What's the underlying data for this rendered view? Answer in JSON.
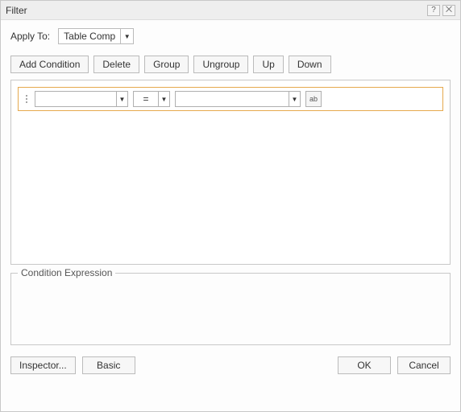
{
  "title": "Filter",
  "applyTo": {
    "label": "Apply To:",
    "value": "Table Comp"
  },
  "toolbar": {
    "addCondition": "Add Condition",
    "delete": "Delete",
    "group": "Group",
    "ungroup": "Ungroup",
    "up": "Up",
    "down": "Down"
  },
  "condition": {
    "field": "",
    "operator": "=",
    "value": "",
    "editHint": "ab"
  },
  "exprLegend": "Condition Expression",
  "exprText": "",
  "footer": {
    "inspector": "Inspector...",
    "basic": "Basic",
    "ok": "OK",
    "cancel": "Cancel"
  },
  "icons": {
    "help": "?",
    "close": "⨉",
    "arrowDown": "▼"
  }
}
